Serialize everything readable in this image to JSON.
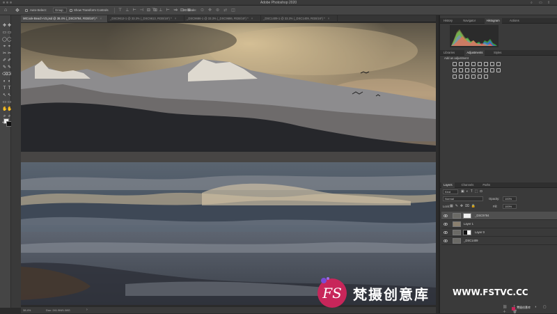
{
  "app": {
    "title": "Adobe Photoshop 2020"
  },
  "options_bar": {
    "auto_select_label": "Auto-Select:",
    "auto_select_value": "Group",
    "transform_label": "Show Transform Controls",
    "mode_3d_label": "3D Mode:"
  },
  "tabs": [
    {
      "label": "MtCook-Beach-V3.psd @ 38.4% (_DSC9784, RGB/16*) *",
      "active": true
    },
    {
      "label": "_DSC9613-1 @ 33.3% (_DSC9613, RGB/16*) *",
      "active": false
    },
    {
      "label": "_DSC9686-1 @ 33.3% (_DSC9686, RGB/16*) *",
      "active": false
    },
    {
      "label": "_DSC1409-1 @ 33.3% (_DSC1409, RGB/16*) *",
      "active": false
    }
  ],
  "status": {
    "zoom": "38.4%",
    "doc": "Doc: 241.9M/1.08G"
  },
  "panels": {
    "top_tabs": [
      "History",
      "Navigator",
      "Histogram",
      "Actions"
    ],
    "top_active": "Histogram",
    "mid_tabs": [
      "Libraries",
      "Adjustments",
      "Styles"
    ],
    "mid_active": "Adjustments",
    "adjustments_heading": "Add an adjustment",
    "layers_tabs": [
      "Layers",
      "Channels",
      "Paths"
    ],
    "layers_active": "Layers",
    "kind_label": "Kind",
    "blend_mode": "Normal",
    "opacity_label": "Opacity:",
    "opacity_value": "100%",
    "lock_label": "Lock:",
    "fill_label": "Fill:",
    "fill_value": "100%",
    "layers": [
      {
        "name": "_DSC9784",
        "selected": true,
        "kind": "masked"
      },
      {
        "name": "Layer 1",
        "selected": false,
        "kind": "plain"
      },
      {
        "name": "Layer 0",
        "selected": false,
        "kind": "masked-dark"
      },
      {
        "name": "_DSC1409",
        "selected": false,
        "kind": "photo"
      }
    ]
  },
  "watermark": {
    "logo_text": "FS",
    "cn_text": "梵摄创意库",
    "url": "WWW.FSTVC.CC",
    "small": "梵摄创意库"
  },
  "colors": {
    "accent": "#c8265a",
    "panel": "#3a3a3a",
    "selected_layer": "#4f4f4f"
  }
}
